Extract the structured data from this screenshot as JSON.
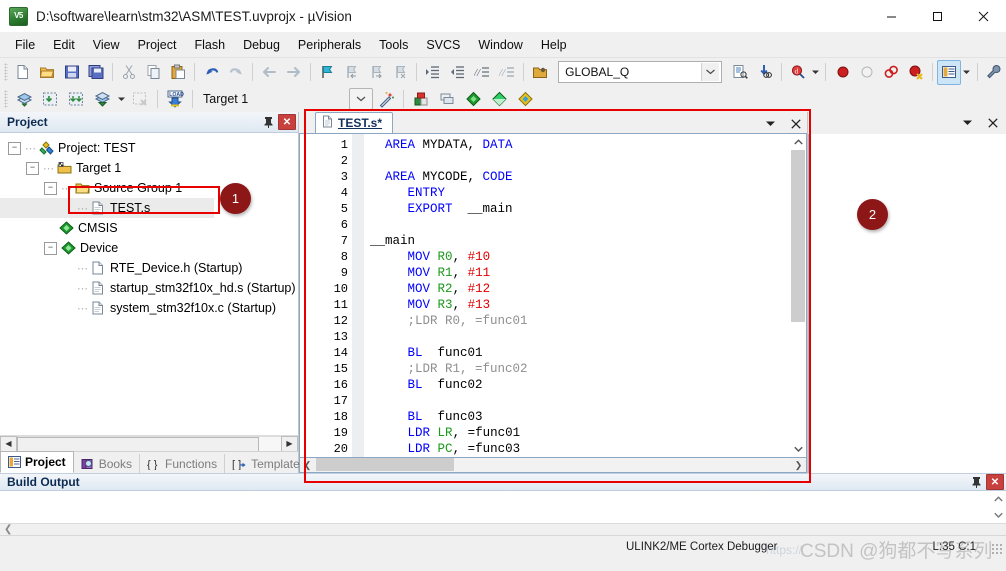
{
  "window": {
    "title": "D:\\software\\learn\\stm32\\ASM\\TEST.uvprojx - µVision",
    "app_icon_text": "V5",
    "controls": {
      "minimize": "minimize-icon",
      "maximize": "maximize-icon",
      "close": "close-icon"
    }
  },
  "menu": [
    "File",
    "Edit",
    "View",
    "Project",
    "Flash",
    "Debug",
    "Peripherals",
    "Tools",
    "SVCS",
    "Window",
    "Help"
  ],
  "toolbar1": [
    "new-file-icon",
    "open-file-icon",
    "save-icon",
    "save-all-icon",
    "cut-icon",
    "copy-icon",
    "paste-icon",
    "undo-icon",
    "redo-icon",
    "navigate-back-icon",
    "navigate-forward-icon",
    "bookmark-toggle-icon",
    "bookmark-prev-icon",
    "bookmark-next-icon",
    "bookmark-clear-icon",
    "indent-icon",
    "outdent-icon",
    "comment-icon",
    "uncomment-icon"
  ],
  "toolbar1_right": {
    "open-project-icon": "open-project-icon",
    "search_value": "GLOBAL_Q",
    "search_placeholder": "",
    "dropdown-icon": "chevron-down-icon",
    "find-in-files-icon": "find-in-files-icon",
    "incremental-find-icon": "incremental-find-icon",
    "browse-symbol-icon": "browse-symbol-icon",
    "breakpoint-icon": "breakpoint-icon",
    "breakpoint-disable-icon": "breakpoint-disable-icon",
    "breakpoint-kill-all-icon": "breakpoint-kill-all-icon",
    "breakpoint-disable-all-icon": "breakpoint-disable-all-icon",
    "window-layout-icon": "window-layout-icon",
    "configure-icon": "configure-icon"
  },
  "toolbar2": {
    "build-icon": "build-icon",
    "rebuild-icon": "rebuild-icon",
    "batch-build-icon": "batch-build-icon",
    "translate-icon": "translate-icon",
    "stop-build-icon": "stop-build-icon",
    "load-icon": "download-load-icon",
    "target_value": "Target 1",
    "target-dropdown-icon": "chevron-down-icon",
    "magic-wand-icon": "magic-wand-icon",
    "target-options-icon": "target-options-icon",
    "manage-components-icon": "manage-components-icon",
    "pack-installer-icon": "pack-installer-icon",
    "manage-run-env-icon": "manage-run-env-icon",
    "select-sw-packs-icon": "select-sw-packs-icon"
  },
  "project_panel": {
    "title": "Project",
    "pin_icon": "pin-icon",
    "close_label": "✕",
    "tree": [
      {
        "label": "Project: TEST",
        "icon": "project-icon",
        "depth": 0,
        "expander": "minus",
        "dots": false
      },
      {
        "label": "Target 1",
        "icon": "target-icon",
        "depth": 1,
        "expander": "minus",
        "dots": true
      },
      {
        "label": "Source Group 1",
        "icon": "folder-icon",
        "depth": 2,
        "expander": "minus",
        "dots": true
      },
      {
        "label": "TEST.s",
        "icon": "asm-file-icon",
        "depth": 3,
        "expander": "none",
        "dots": true,
        "selected": true
      },
      {
        "label": "CMSIS",
        "icon": "component-icon",
        "depth": 2,
        "expander": "none",
        "dots": false
      },
      {
        "label": "Device",
        "icon": "component-icon",
        "depth": 2,
        "expander": "minus",
        "dots": false
      },
      {
        "label": "RTE_Device.h (Startup)",
        "icon": "header-file-icon",
        "depth": 3,
        "expander": "none",
        "dots": true
      },
      {
        "label": "startup_stm32f10x_hd.s (Startup)",
        "icon": "asm-file-icon",
        "depth": 3,
        "expander": "none",
        "dots": true
      },
      {
        "label": "system_stm32f10x.c (Startup)",
        "icon": "c-file-icon",
        "depth": 3,
        "expander": "none",
        "dots": true
      }
    ],
    "tabs": [
      {
        "label": "Project",
        "icon": "project-tab-icon",
        "selected": true
      },
      {
        "label": "Books",
        "icon": "books-tab-icon",
        "selected": false
      },
      {
        "label": "Functions",
        "icon": "functions-tab-icon",
        "selected": false
      },
      {
        "label": "Templates",
        "icon": "templates-tab-icon",
        "selected": false
      }
    ]
  },
  "editor": {
    "tab": {
      "label": "TEST.s*",
      "icon": "asm-file-icon"
    },
    "tabrow_buttons": {
      "dropdown": "chevron-down-icon",
      "close": "close-icon"
    },
    "lines": [
      {
        "n": "1",
        "tokens": [
          {
            "t": "  ",
            "c": ""
          },
          {
            "t": "AREA",
            "c": "kw"
          },
          {
            "t": " MYDATA, ",
            "c": ""
          },
          {
            "t": "DATA",
            "c": "kw"
          }
        ]
      },
      {
        "n": "2",
        "tokens": []
      },
      {
        "n": "3",
        "tokens": [
          {
            "t": "  ",
            "c": ""
          },
          {
            "t": "AREA",
            "c": "kw"
          },
          {
            "t": " MYCODE, ",
            "c": ""
          },
          {
            "t": "CODE",
            "c": "kw"
          }
        ]
      },
      {
        "n": "4",
        "tokens": [
          {
            "t": "     ",
            "c": ""
          },
          {
            "t": "ENTRY",
            "c": "kw"
          }
        ]
      },
      {
        "n": "5",
        "tokens": [
          {
            "t": "     ",
            "c": ""
          },
          {
            "t": "EXPORT",
            "c": "kw"
          },
          {
            "t": "  __main",
            "c": ""
          }
        ]
      },
      {
        "n": "6",
        "tokens": []
      },
      {
        "n": "7",
        "tokens": [
          {
            "t": "__main",
            "c": ""
          }
        ]
      },
      {
        "n": "8",
        "tokens": [
          {
            "t": "     ",
            "c": ""
          },
          {
            "t": "MOV",
            "c": "kw"
          },
          {
            "t": " ",
            "c": ""
          },
          {
            "t": "R0",
            "c": "reg"
          },
          {
            "t": ", ",
            "c": ""
          },
          {
            "t": "#10",
            "c": "num"
          }
        ]
      },
      {
        "n": "9",
        "tokens": [
          {
            "t": "     ",
            "c": ""
          },
          {
            "t": "MOV",
            "c": "kw"
          },
          {
            "t": " ",
            "c": ""
          },
          {
            "t": "R1",
            "c": "reg"
          },
          {
            "t": ", ",
            "c": ""
          },
          {
            "t": "#11",
            "c": "num"
          }
        ]
      },
      {
        "n": "10",
        "tokens": [
          {
            "t": "     ",
            "c": ""
          },
          {
            "t": "MOV",
            "c": "kw"
          },
          {
            "t": " ",
            "c": ""
          },
          {
            "t": "R2",
            "c": "reg"
          },
          {
            "t": ", ",
            "c": ""
          },
          {
            "t": "#12",
            "c": "num"
          }
        ]
      },
      {
        "n": "11",
        "tokens": [
          {
            "t": "     ",
            "c": ""
          },
          {
            "t": "MOV",
            "c": "kw"
          },
          {
            "t": " ",
            "c": ""
          },
          {
            "t": "R3",
            "c": "reg"
          },
          {
            "t": ", ",
            "c": ""
          },
          {
            "t": "#13",
            "c": "num"
          }
        ]
      },
      {
        "n": "12",
        "tokens": [
          {
            "t": "     ;LDR R0, =func01",
            "c": "cmt"
          }
        ]
      },
      {
        "n": "13",
        "tokens": []
      },
      {
        "n": "14",
        "tokens": [
          {
            "t": "     ",
            "c": ""
          },
          {
            "t": "BL",
            "c": "kw"
          },
          {
            "t": "  func01",
            "c": ""
          }
        ]
      },
      {
        "n": "15",
        "tokens": [
          {
            "t": "     ;LDR R1, =func02",
            "c": "cmt"
          }
        ]
      },
      {
        "n": "16",
        "tokens": [
          {
            "t": "     ",
            "c": ""
          },
          {
            "t": "BL",
            "c": "kw"
          },
          {
            "t": "  func02",
            "c": ""
          }
        ]
      },
      {
        "n": "17",
        "tokens": []
      },
      {
        "n": "18",
        "tokens": [
          {
            "t": "     ",
            "c": ""
          },
          {
            "t": "BL",
            "c": "kw"
          },
          {
            "t": "  func03",
            "c": ""
          }
        ]
      },
      {
        "n": "19",
        "tokens": [
          {
            "t": "     ",
            "c": ""
          },
          {
            "t": "LDR",
            "c": "kw"
          },
          {
            "t": " ",
            "c": ""
          },
          {
            "t": "LR",
            "c": "reg"
          },
          {
            "t": ", =func01",
            "c": ""
          }
        ]
      },
      {
        "n": "20",
        "tokens": [
          {
            "t": "     ",
            "c": ""
          },
          {
            "t": "LDR",
            "c": "kw"
          },
          {
            "t": " ",
            "c": ""
          },
          {
            "t": "PC",
            "c": "reg"
          },
          {
            "t": ", =func03",
            "c": ""
          }
        ]
      }
    ]
  },
  "build_output": {
    "title": "Build Output",
    "content": "",
    "pin_icon": "pin-icon",
    "close_label": "✕"
  },
  "status_bar": {
    "debugger": "ULINK2/ME Cortex Debugger",
    "position": "L:35 C:1"
  },
  "annotations": {
    "badge1": "1",
    "badge2": "2",
    "badge_color": "#8d1616",
    "rect_color": "#e60000"
  },
  "watermark": {
    "text": "CSDN @狗都不写系列",
    "url": "https://"
  }
}
